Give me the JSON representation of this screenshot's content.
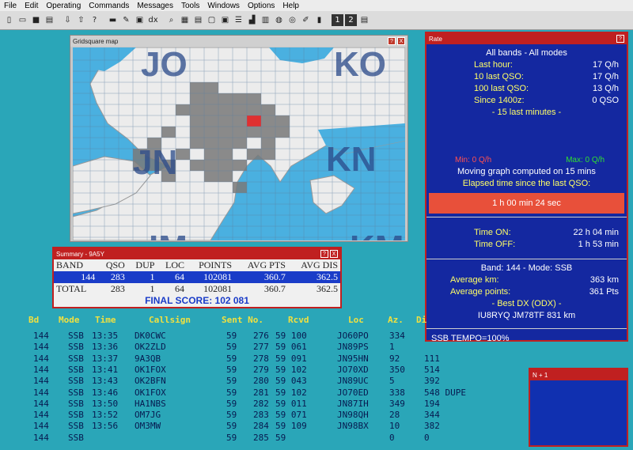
{
  "menu": [
    "File",
    "Edit",
    "Operating",
    "Commands",
    "Messages",
    "Tools",
    "Windows",
    "Options",
    "Help"
  ],
  "toolbar_icons": [
    "new-file-icon",
    "open-folder-icon",
    "save-icon",
    "save-all-icon",
    "down-arrow-icon",
    "up-arrow-icon",
    "question-icon",
    "cassette-icon",
    "pencil-icon",
    "clipboard-icon",
    "dx-icon",
    "search-icon",
    "grid-icon",
    "notes-icon",
    "window-icon",
    "frame-icon",
    "list-icon",
    "chart-icon",
    "rows-icon",
    "globe-icon",
    "target-icon",
    "edit-icon",
    "panel-icon",
    "one-icon",
    "two-icon",
    "three-icon"
  ],
  "map": {
    "title": "Gridsquare map",
    "labels": [
      "JO",
      "KO",
      "JN",
      "KN",
      "IM",
      "KM"
    ],
    "help": "?",
    "close": "X"
  },
  "rate": {
    "title": "Rate",
    "help": "?",
    "heading": "All bands - All modes",
    "rows": [
      {
        "label": "Last hour:",
        "value": "17 Q/h"
      },
      {
        "label": "10 last QSO:",
        "value": "17 Q/h"
      },
      {
        "label": "100 last QSO:",
        "value": "13 Q/h"
      },
      {
        "label": "Since 1400z:",
        "value": "0 QSO"
      }
    ],
    "last_minutes": "- 15 last minutes -",
    "min": "Min: 0 Q/h",
    "max": "Max: 0 Q/h",
    "moving": "Moving graph computed on 15 mins",
    "elapsed_label": "Elapsed time since the last QSO:",
    "elapsed_value": "1 h 00 min 24 sec",
    "time_on_label": "Time ON:",
    "time_on_value": "22 h 04 min",
    "time_off_label": "Time OFF:",
    "time_off_value": "1 h 53 min",
    "band_mode": "Band: 144 - Mode: SSB",
    "avg_km_label": "Average km:",
    "avg_km_value": "363 km",
    "avg_pts_label": "Average points:",
    "avg_pts_value": "361 Pts",
    "best_dx_label": "- Best DX (ODX) -",
    "best_dx_value": "IU8RYQ  JM78TF  831 km",
    "tempo": "SSB  TEMPO=100%"
  },
  "summary": {
    "title": "Summary - 9A5Y",
    "close": "X",
    "help": "?",
    "headers": [
      "BAND",
      "QSO",
      "DUP",
      "LOC",
      "POINTS",
      "AVG PTS",
      "AVG DIS"
    ],
    "rows": [
      [
        "144",
        "283",
        "1",
        "64",
        "102081",
        "360.7",
        "362.5"
      ],
      [
        "TOTAL",
        "283",
        "1",
        "64",
        "102081",
        "360.7",
        "362.5"
      ]
    ],
    "final_score": "FINAL SCORE: 102 081"
  },
  "log": {
    "headers": [
      "Bd",
      "Mode",
      "Time",
      "Callsign",
      "Sent No.",
      "Rcvd",
      "Loc",
      "Az.",
      "Di"
    ],
    "rows": [
      [
        "144",
        "SSB",
        "13:35",
        "DK0CWC",
        "59",
        "276",
        "59 100",
        "JO60PO",
        "334",
        ""
      ],
      [
        "144",
        "SSB",
        "13:36",
        "OK2ZLD",
        "59",
        "277",
        "59 061",
        "JN89PS",
        "1",
        ""
      ],
      [
        "144",
        "SSB",
        "13:37",
        "9A3QB",
        "59",
        "278",
        "59 091",
        "JN95HN",
        "92",
        "111"
      ],
      [
        "144",
        "SSB",
        "13:41",
        "OK1FOX",
        "59",
        "279",
        "59 102",
        "JO70XD",
        "350",
        "514"
      ],
      [
        "144",
        "SSB",
        "13:43",
        "OK2BFN",
        "59",
        "280",
        "59 043",
        "JN89UC",
        "5",
        "392"
      ],
      [
        "144",
        "SSB",
        "13:46",
        "OK1FOX",
        "59",
        "281",
        "59 102",
        "JO70ED",
        "338",
        "548 DUPE"
      ],
      [
        "144",
        "SSB",
        "13:50",
        "HA1NBS",
        "59",
        "282",
        "59 011",
        "JN87IH",
        "349",
        "194"
      ],
      [
        "144",
        "SSB",
        "13:52",
        "OM7JG",
        "59",
        "283",
        "59 071",
        "JN98QH",
        "28",
        "344"
      ],
      [
        "144",
        "SSB",
        "13:56",
        "OM3MW",
        "59",
        "284",
        "59 109",
        "JN98BX",
        "10",
        "382"
      ],
      [
        "144",
        "SSB",
        "",
        "",
        "59",
        "285",
        "59",
        "",
        "0",
        "0"
      ]
    ]
  },
  "n1": {
    "title": "N + 1"
  },
  "colors": {
    "rate_bg": "#1428a0",
    "accent_red": "#c02020",
    "elapsed_bar": "#e8503a",
    "log_header": "#f0e040",
    "screen_bg": "#2aa6b8"
  }
}
